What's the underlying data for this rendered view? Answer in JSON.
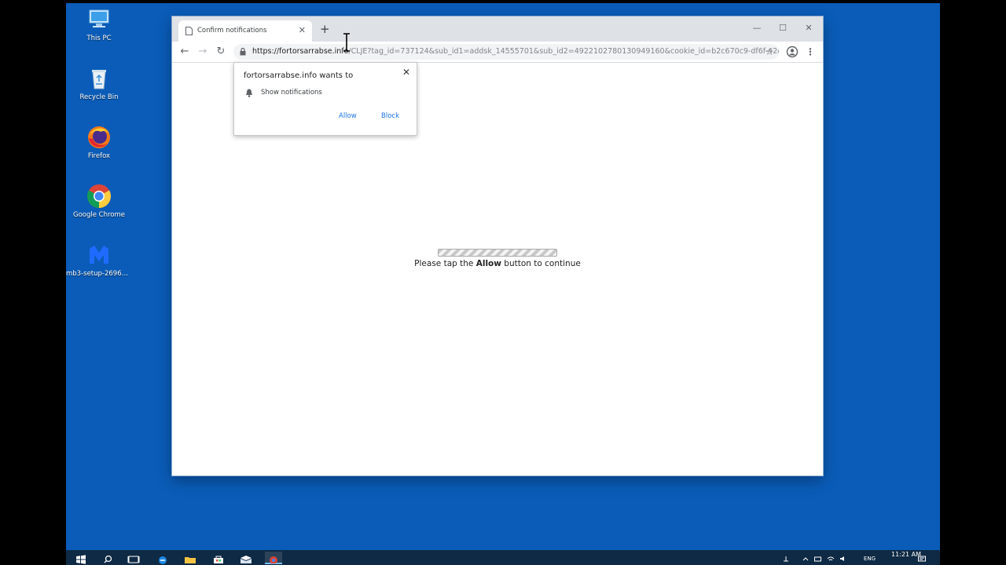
{
  "desktop": {
    "icons": [
      {
        "label": "This PC"
      },
      {
        "label": "Recycle Bin"
      },
      {
        "label": "Firefox"
      },
      {
        "label": "Google Chrome"
      },
      {
        "label": "mb3-setup-26964.2..."
      }
    ]
  },
  "browser": {
    "tab_title": "Confirm notifications",
    "url_host": "https://fortorsarrabse.info",
    "url_rest": "/CLJE?tag_id=737124&sub_id1=addsk_14555701&sub_id2=4922102780130949160&cookie_id=b2c670c9-df6f-42c..."
  },
  "permission": {
    "title": "fortorsarrabse.info wants to",
    "item": "Show notifications",
    "allow_label": "Allow",
    "block_label": "Block"
  },
  "page": {
    "msg_before": "Please tap the ",
    "msg_bold": "Allow",
    "msg_after": " button to continue"
  },
  "taskbar": {
    "language": "ENG",
    "clock": "11:21 AM"
  },
  "colors": {
    "desktop_bg": "#0a5cb8",
    "accent": "#1a73e8",
    "taskbar": "#0f2a44"
  }
}
